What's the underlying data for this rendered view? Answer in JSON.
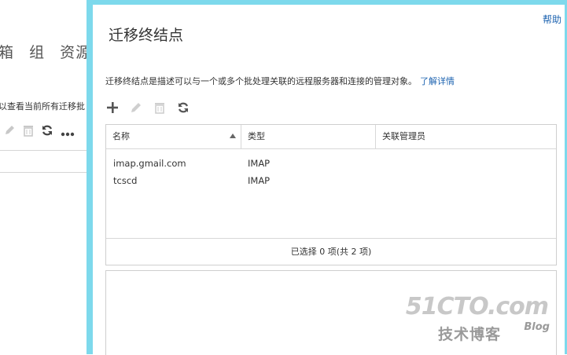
{
  "background": {
    "nav_items": [
      "箱",
      "组",
      "资源"
    ],
    "description": "以查看当前所有迁移批"
  },
  "dialog": {
    "help": "帮助",
    "title": "迁移终结点",
    "description": "迁移终结点是描述可以与一个或多个批处理关联的远程服务器和连接的管理对象。",
    "learn_more": "了解详情",
    "toolbar": [
      "add-icon",
      "edit-icon",
      "delete-icon",
      "refresh-icon"
    ],
    "table": {
      "columns": [
        "名称",
        "类型",
        "关联管理员"
      ],
      "rows": [
        {
          "name": "imap.gmail.com",
          "type": "IMAP"
        },
        {
          "name": "tcscd",
          "type": "IMAP"
        }
      ],
      "footer": "已选择 0 项(共 2 项)"
    }
  },
  "watermark": {
    "main": "51CTO.com",
    "sub": "技术博客",
    "blog": "Blog"
  },
  "colors": {
    "accent": "#1d63b0",
    "frame": "#7dd9ec"
  }
}
